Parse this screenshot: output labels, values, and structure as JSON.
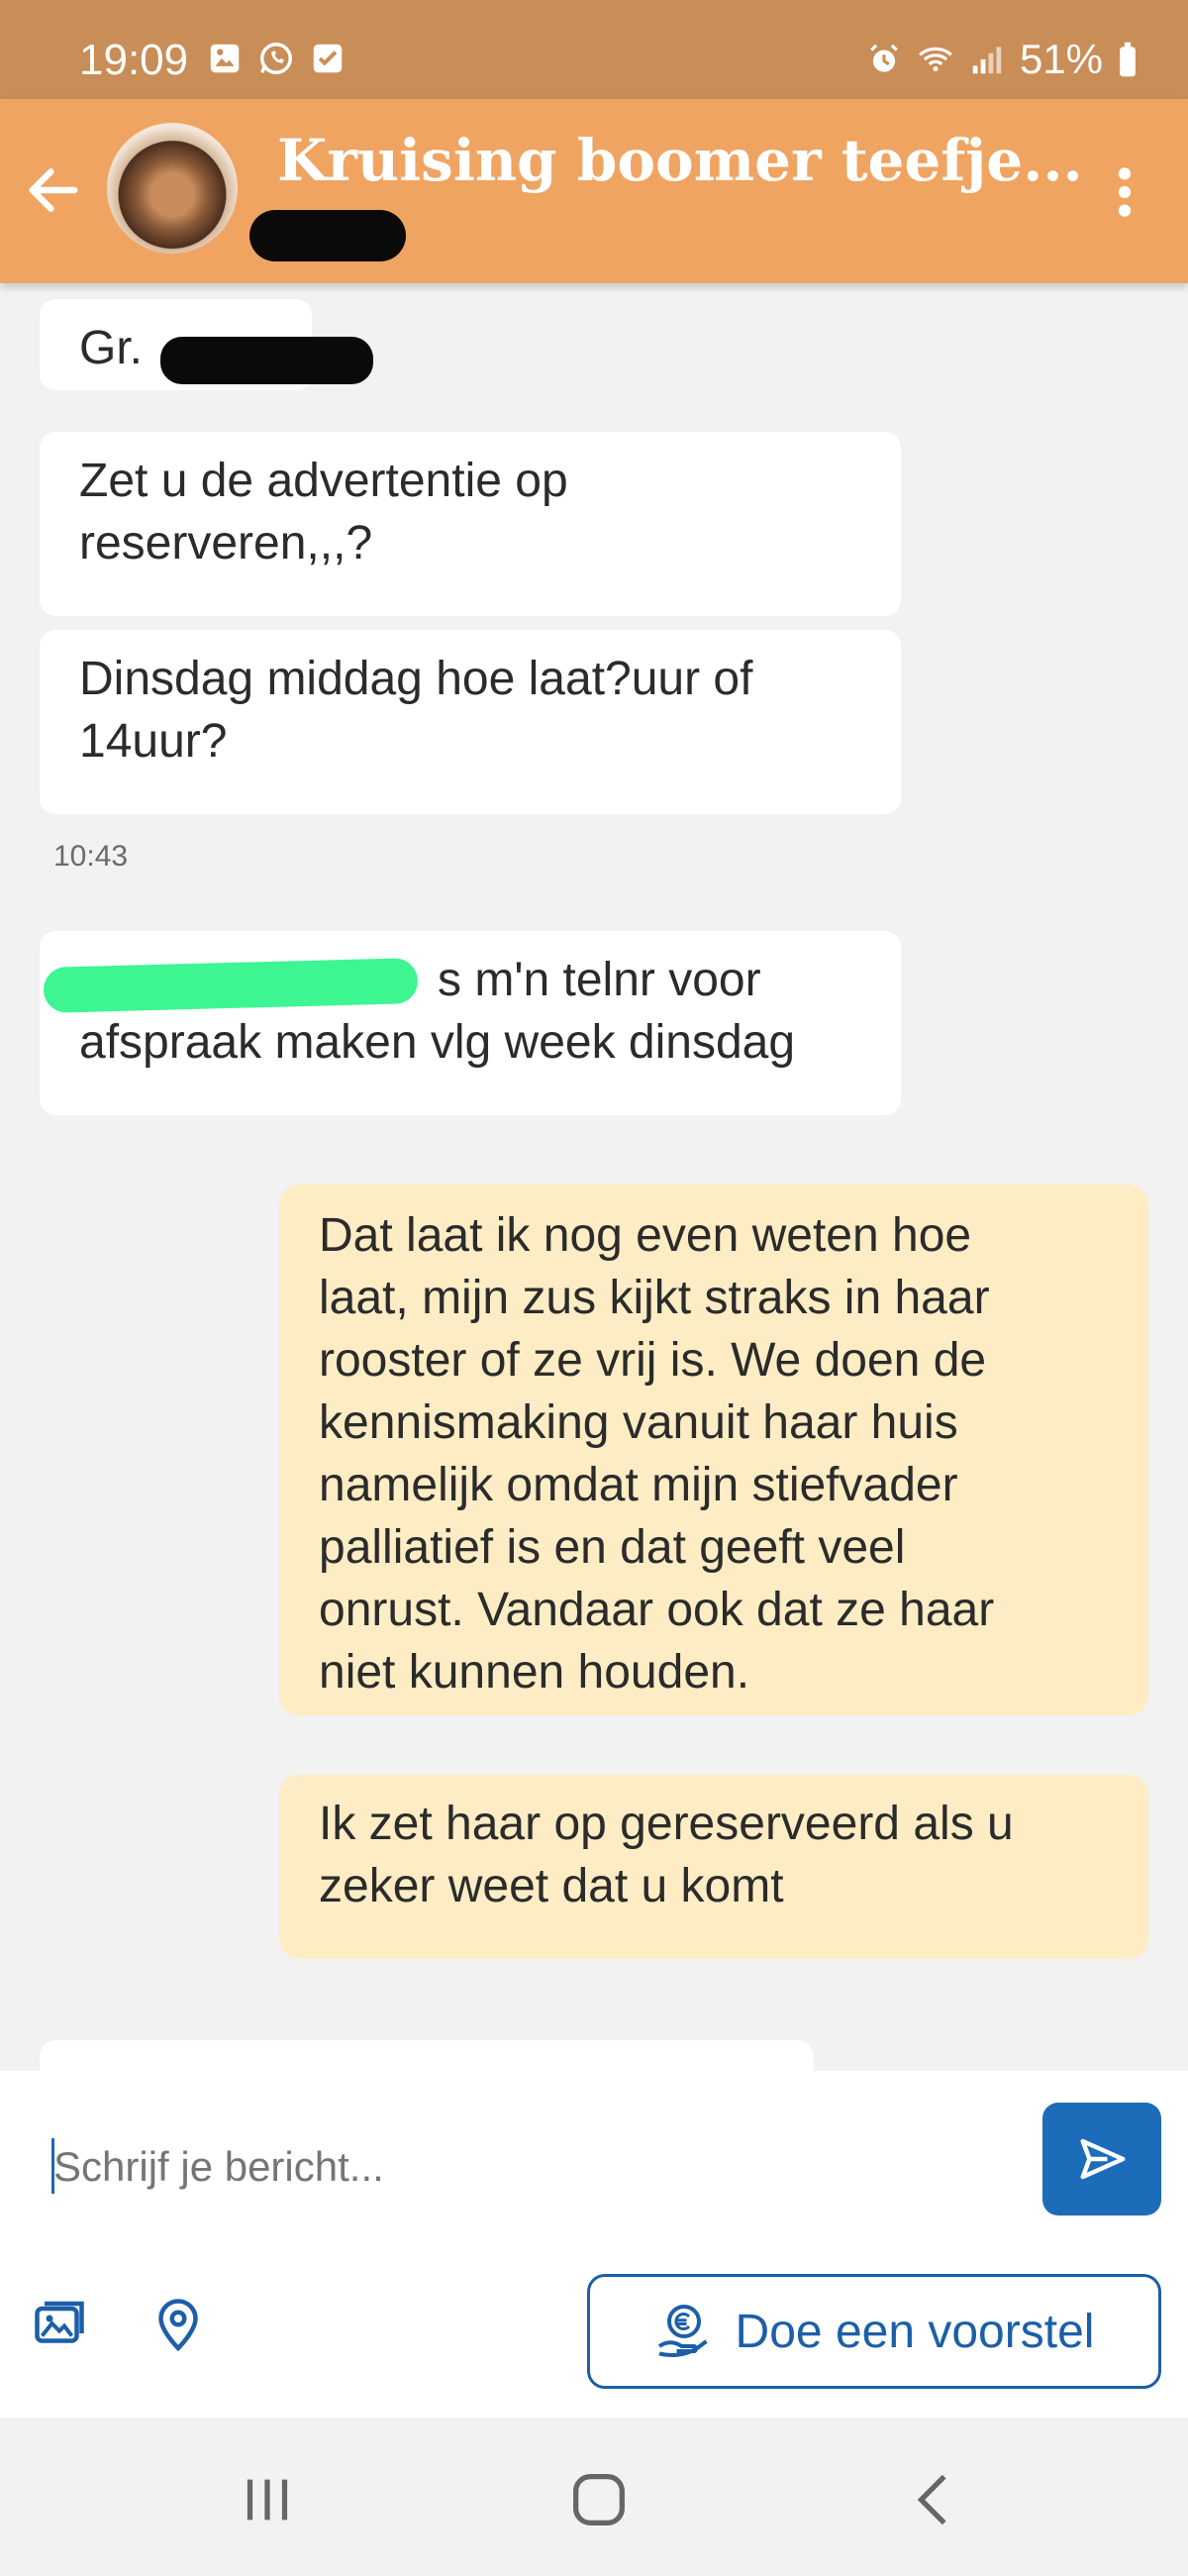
{
  "status_bar": {
    "time": "19:09",
    "battery": "51%"
  },
  "header": {
    "title": "Kruising boomer teefje..."
  },
  "messages": {
    "m1": "Gr.",
    "m2_l1": "Zet u de advertentie op",
    "m2_l2": "reserveren,,,?",
    "m3_l1": "Dinsdag middag hoe laat?uur of",
    "m3_l2": "14uur?",
    "timestamp": "10:43",
    "m4_l1": "s m'n telnr voor",
    "m4_l2": "afspraak maken vlg week dinsdag",
    "m5": [
      "Dat laat ik nog even weten hoe",
      "laat, mijn zus kijkt straks in haar",
      "rooster of ze vrij is. We doen de",
      "kennismaking vanuit haar huis",
      "namelijk omdat mijn stiefvader",
      "palliatief is en dat geeft veel",
      "onrust. Vandaar ook dat ze haar",
      "niet kunnen houden."
    ],
    "m6_l1": "Ik zet haar op gereserveerd als u",
    "m6_l2": "zeker weet dat u komt"
  },
  "composer": {
    "placeholder": "Schrijf je bericht..."
  },
  "actions": {
    "offer_label": "Doe een voorstel"
  },
  "icons": {
    "back": "arrow-left-icon",
    "menu": "more-vertical-icon",
    "send": "send-icon",
    "gallery": "image-gallery-icon",
    "location": "location-pin-icon",
    "offer": "euro-hand-icon"
  },
  "colors": {
    "header": "#f0a462",
    "status_bar": "#c98d57",
    "outgoing": "#fdecc4",
    "accent": "#1c6cb9"
  }
}
